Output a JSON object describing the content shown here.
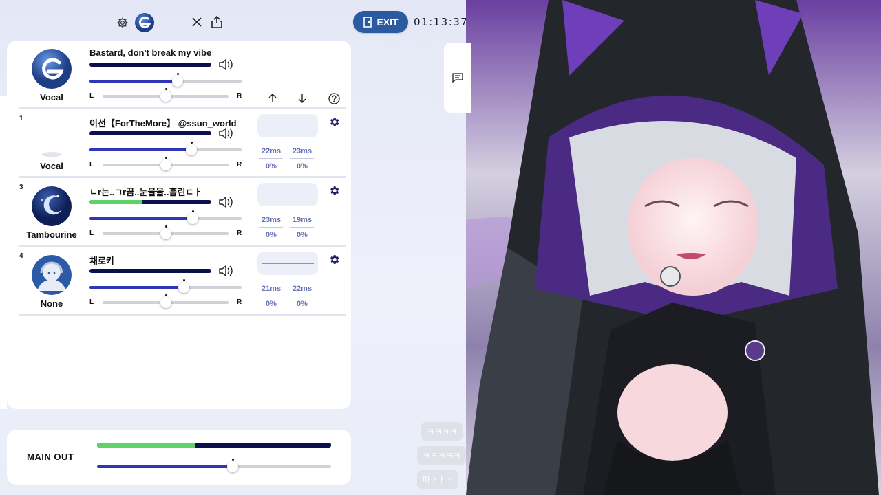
{
  "header": {
    "exit_label": "EXIT",
    "timer": "01:13:37"
  },
  "tracks": [
    {
      "num": "",
      "title": "Bastard, don't break my vibe",
      "avatar_label": "Vocal",
      "meter": 0,
      "volume": 0.58,
      "pan": 0.5
    },
    {
      "num": "1",
      "title": "이선【ForTheMore】 @ssun_world",
      "avatar_label": "Vocal",
      "meter": 0,
      "volume": 0.67,
      "pan": 0.5,
      "lat_in": "22ms",
      "lat_out": "23ms",
      "loss_in": "0%",
      "loss_out": "0%"
    },
    {
      "num": "3",
      "title": "ㄴr는..ㄱr끔..눈물울..흘린ㄷㅏ",
      "avatar_label": "Tambourine",
      "meter": 0.43,
      "volume": 0.68,
      "pan": 0.5,
      "lat_in": "23ms",
      "lat_out": "19ms",
      "loss_in": "0%",
      "loss_out": "0%"
    },
    {
      "num": "4",
      "title": "채로키",
      "avatar_label": "None",
      "meter": 0,
      "volume": 0.62,
      "pan": 0.5,
      "lat_in": "21ms",
      "lat_out": "22ms",
      "loss_in": "0%",
      "loss_out": "0%"
    }
  ],
  "pan_labels": {
    "left": "L",
    "right": "R"
  },
  "main_out": {
    "label": "MAIN OUT",
    "meter": 0.42,
    "volume": 0.58
  },
  "chat": {
    "messages": [
      "ㅋㅋㅋㅋ",
      "ㅋㅋㅋㅋㅋ",
      "따ㅏㅏㅏ"
    ]
  },
  "colors": {
    "accent": "#2f36b8",
    "meter_bg": "#0c0f4d",
    "meter_level": "#5fd36a",
    "exit_bg": "#2c5aa0"
  }
}
